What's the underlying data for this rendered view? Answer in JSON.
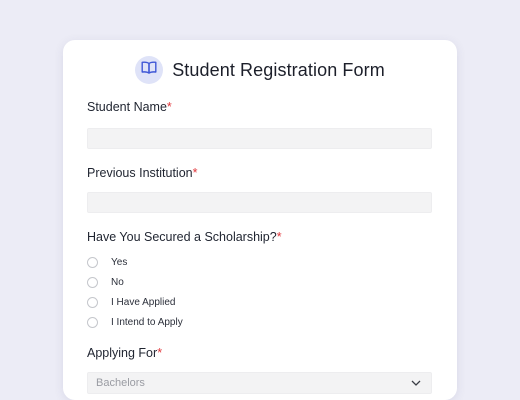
{
  "form": {
    "title": "Student Registration Form",
    "logo_icon": "book-icon",
    "accent_color": "#3f57d6",
    "required_mark": "*",
    "required_color": "#e0363a"
  },
  "fields": {
    "student_name": {
      "label": "Student Name",
      "value": ""
    },
    "previous_institution": {
      "label": "Previous Institution",
      "value": ""
    },
    "scholarship": {
      "label": "Have You Secured a Scholarship?",
      "options": [
        "Yes",
        "No",
        "I Have Applied",
        "I Intend to Apply"
      ],
      "selected": null
    },
    "applying_for": {
      "label": "Applying For",
      "selected": "Bachelors"
    }
  }
}
